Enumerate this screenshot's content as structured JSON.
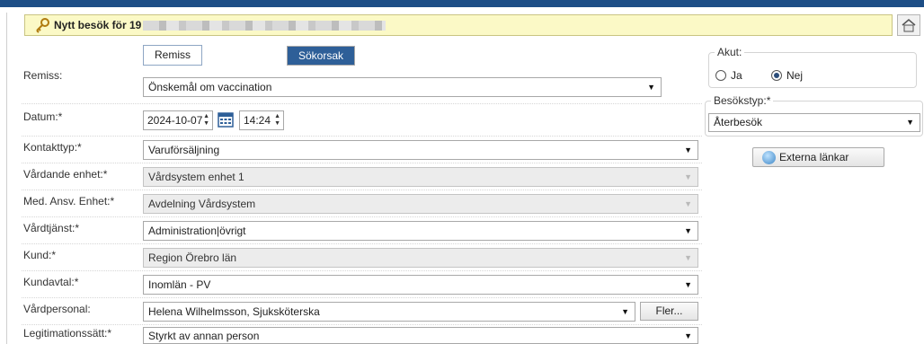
{
  "header": {
    "title": "Nytt besök för 19"
  },
  "remiss": {
    "label": "Remiss:",
    "tabs": [
      "Remiss",
      "Sökorsak"
    ],
    "value": "Önskemål om vaccination"
  },
  "datum": {
    "label": "Datum:*",
    "date": "2024-10-07",
    "time": "14:24"
  },
  "fields": [
    {
      "label": "Kontakttyp:*",
      "value": "Varuförsäljning"
    },
    {
      "label": "Vårdande enhet:*",
      "value": "Vårdsystem enhet 1"
    },
    {
      "label": "Med. Ansv. Enhet:*",
      "value": "Avdelning Vårdsystem"
    },
    {
      "label": "Vårdtjänst:*",
      "value": "Administration|övrigt"
    },
    {
      "label": "Kund:*",
      "value": "Region Örebro län"
    },
    {
      "label": "Kundavtal:*",
      "value": "Inomlän - PV"
    },
    {
      "label": "Vårdpersonal:",
      "value": "Helena Wilhelmsson, Sjuksköterska"
    },
    {
      "label": "Legitimationssätt:*",
      "value": "Styrkt av annan person"
    }
  ],
  "fler": "Fler...",
  "akut": {
    "legend": "Akut:",
    "yes": "Ja",
    "no": "Nej",
    "selected": "Nej"
  },
  "besokstyp": {
    "legend": "Besökstyp:*",
    "value": "Återbesök"
  },
  "externa": "Externa länkar",
  "colors": {
    "topbar": "#1d4e86",
    "selected_tab": "#2e5f98",
    "title_bg": "#fbf9c6"
  }
}
